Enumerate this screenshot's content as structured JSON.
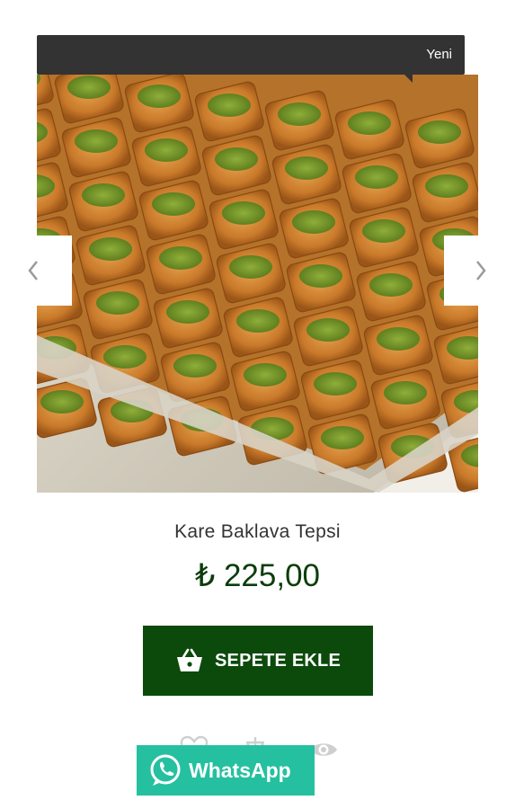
{
  "badge": {
    "label": "Yeni"
  },
  "product": {
    "title": "Kare Baklava Tepsi",
    "price": "₺ 225,00",
    "image_icon": "baklava-tray-image"
  },
  "carousel": {
    "prev_icon": "chevron-left-icon",
    "next_icon": "chevron-right-icon"
  },
  "cart_button": {
    "label": "SEPETE EKLE",
    "icon": "basket-icon"
  },
  "actions": {
    "wishlist_icon": "heart-icon",
    "compare_icon": "compare-icon",
    "quickview_icon": "eye-icon"
  },
  "whatsapp": {
    "label": "WhatsApp",
    "icon": "whatsapp-icon"
  },
  "colors": {
    "badge_bg": "#333333",
    "price": "#0b3d0b",
    "cart_bg": "#0b4a0b",
    "whatsapp_bg": "#25c0a0"
  }
}
